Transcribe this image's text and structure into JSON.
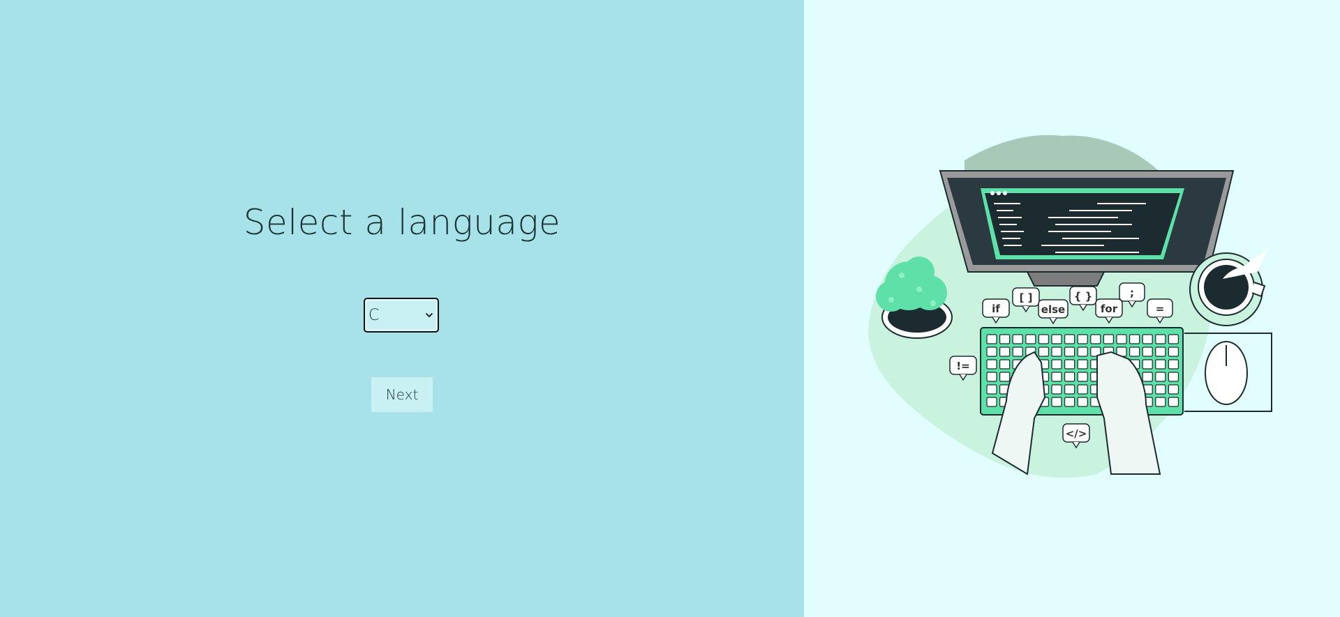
{
  "form": {
    "title": "Select a language",
    "language_select": {
      "selected": "C",
      "options": [
        "C"
      ]
    },
    "next_label": "Next"
  },
  "illustration": {
    "keyword_bubbles": [
      "if",
      "[ ]",
      "else",
      "{ }",
      "for",
      ";",
      "=",
      "!=",
      "</>"
    ]
  },
  "colors": {
    "left_panel_bg": "#a6e2e8",
    "right_panel_bg": "#e1fdfd",
    "control_bg": "#c9f0f2",
    "accent_green": "#5ee0a8"
  }
}
